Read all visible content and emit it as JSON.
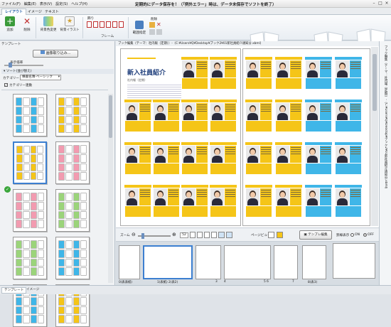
{
  "app": {
    "title": "定期的にデータ保存を！（「例外エラー」時は、データ未保存でソフトを終了）"
  },
  "menu": [
    "ファイル(F)",
    "編集(E)",
    "表示(V)",
    "設定(S)",
    "ヘルプ(H)"
  ],
  "tabs": [
    "レイアウト",
    "イメージ",
    "テキスト"
  ],
  "ribbon": {
    "add": "追加",
    "delete": "削除",
    "bg_change": "背景色変更",
    "bg_illust": "背景イラスト",
    "frame": "フレーム",
    "frame_label": "飾り",
    "range": "範囲指定",
    "delete2": "削除"
  },
  "left": {
    "header": "テンプレート",
    "load_button": "画像取り込み...",
    "display_ratio": "表示倍率",
    "sort_label": "ソート(並び替え)",
    "category_label": "カテゴリー",
    "category_value": "横書名簿-ベーシック",
    "category_link": "カテゴリー連動"
  },
  "canvas": {
    "header": "ブック編集（テーマ：社内報（定期））-（C:¥Users¥Q¥Desktop¥ブック2¥01新社員紹介通知分.xbml）",
    "doc_title": "新入社員紹介",
    "doc_sub": "社内報（定期）"
  },
  "bottom": {
    "zoom_label": "ズーム",
    "zoom_value": "52",
    "page_label": "ページビュー",
    "template_edit": "テンプレ編集",
    "guide_label": "罫線表示",
    "on": "ON",
    "off": "OFF"
  },
  "film_labels": [
    "0(表表紙)",
    "1(表紙) 2(表2)",
    "3",
    "4",
    "5  6",
    "7",
    "8(表3)"
  ],
  "status": {
    "tab1": "テンプレート",
    "tab2": "イメージ"
  },
  "colors": {
    "yellow": "#f5c518",
    "blue": "#3fb6e8",
    "accent": "#1c58a3"
  }
}
